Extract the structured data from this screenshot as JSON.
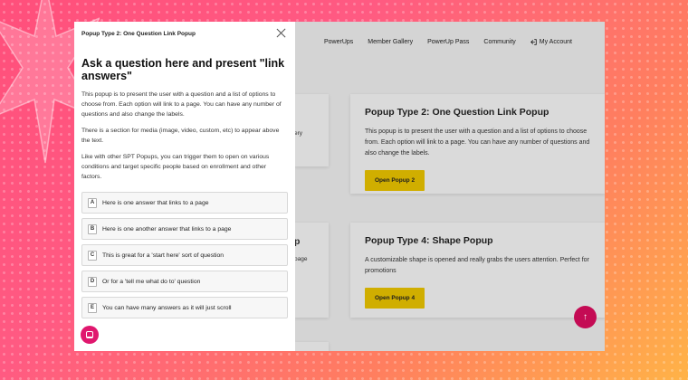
{
  "colors": {
    "accent_pink": "#e0176e",
    "button_yellow": "#e8c200",
    "fab_red": "#c40b54"
  },
  "site_nav": {
    "items": [
      "PowerUps",
      "Member Gallery",
      "PowerUp Pass",
      "Community"
    ],
    "account_label": "My Account",
    "account_icon": "login-icon"
  },
  "cards": {
    "left_top_fragment": "ery",
    "left_mid_title_fragment": "p",
    "left_mid_text_fragment": "page",
    "card2": {
      "title": "Popup Type 2: One Question Link Popup",
      "text": "This popup is to present the user with a question and a list of options to choose from. Each option will link to a page. You can have any number of questions and also change the labels.",
      "button": "Open Popup 2"
    },
    "card4": {
      "title": "Popup Type 4: Shape Popup",
      "text": "A customizable shape is opened and really grabs the users attention. Perfect for promotions",
      "button": "Open Popup 4"
    }
  },
  "popup": {
    "header_title": "Popup Type 2: One Question Link Popup",
    "question": "Ask a question here and present \"link answers\"",
    "paragraphs": [
      "This popup is to present the user with a question and a list of options to choose from. Each option will link to a page. You can have any number of questions and also change the labels.",
      "There is a section for media (image, video, custom, etc) to appear above the text.",
      "Like with other SPT Popups, you can trigger them to open on various conditions and target specific people based on enrollment and other factors."
    ],
    "answers": [
      {
        "letter": "A",
        "text": "Here is one answer that links to a page"
      },
      {
        "letter": "B",
        "text": "Here is one another answer that links to a page"
      },
      {
        "letter": "C",
        "text": "This is great for a 'start here' sort of question"
      },
      {
        "letter": "D",
        "text": "Or for a 'tell me what do to' question"
      },
      {
        "letter": "E",
        "text": "You can have many answers as it will just scroll"
      }
    ]
  }
}
